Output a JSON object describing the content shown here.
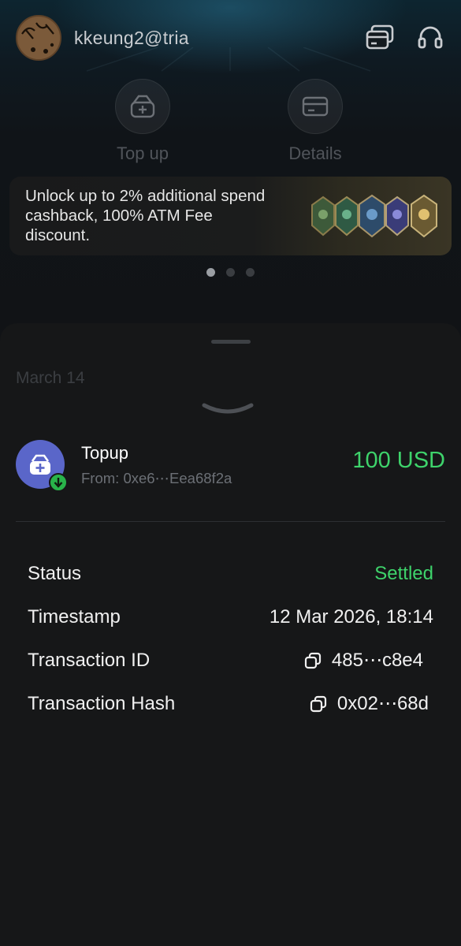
{
  "header": {
    "username": "kkeung2@tria",
    "icons": [
      "avatar",
      "cards-icon",
      "headset-icon"
    ]
  },
  "actions": [
    {
      "label": "Top up",
      "icon": "wallet-plus-icon"
    },
    {
      "label": "Details",
      "icon": "card-icon"
    }
  ],
  "banner": {
    "text": "Unlock up to 2% additional spend cashback, 100% ATM Fee discount.",
    "badge_labels": [
      "",
      "",
      "",
      "",
      ""
    ],
    "page_count": 3,
    "active_page": 1
  },
  "sheet": {
    "date_header": "March 14",
    "transaction": {
      "title": "Topup",
      "from": "From: 0xe6⋯Eea68f2a",
      "amount": "100 USD",
      "icon": "wallet-plus-icon",
      "badge_icon": "arrow-down-icon"
    },
    "details": [
      {
        "key": "Status",
        "value": "Settled",
        "copyable": false,
        "highlight": true
      },
      {
        "key": "Timestamp",
        "value": "12 Mar 2026, 18:14",
        "copyable": false,
        "highlight": false
      },
      {
        "key": "Transaction ID",
        "value": "485⋯c8e4",
        "copyable": true,
        "highlight": false
      },
      {
        "key": "Transaction Hash",
        "value": "0x02⋯68d",
        "copyable": true,
        "highlight": false
      }
    ]
  },
  "colors": {
    "accent_green": "#3ed36b",
    "icon_purple": "#5a66c9",
    "background": "#161718"
  }
}
